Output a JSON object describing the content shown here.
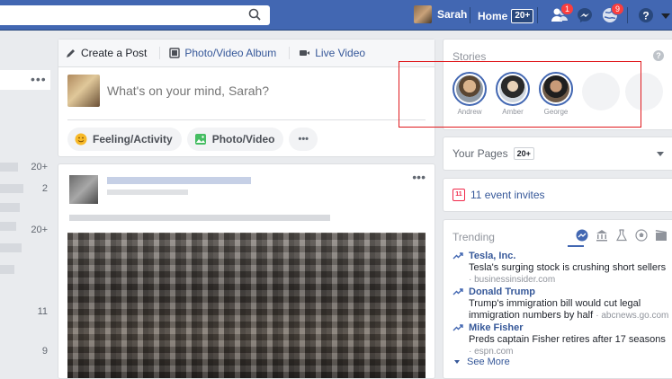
{
  "topbar": {
    "search_placeholder": "",
    "user_name": "Sarah",
    "home_label": "Home",
    "home_count": "20+",
    "friend_requests_count": "1",
    "notifications_count": "9"
  },
  "left_nav": {
    "counts": [
      "20+",
      "2",
      "20+",
      "11",
      "9"
    ]
  },
  "composer": {
    "tab_create": "Create a Post",
    "tab_album": "Photo/Video Album",
    "tab_live": "Live Video",
    "input_placeholder": "What's on your mind, Sarah?",
    "btn_feeling": "Feeling/Activity",
    "btn_photo": "Photo/Video",
    "btn_more": "•••"
  },
  "stories": {
    "title": "Stories",
    "items": [
      {
        "name": "Andrew"
      },
      {
        "name": "Amber"
      },
      {
        "name": "George"
      }
    ]
  },
  "pages": {
    "title": "Your Pages",
    "count": "20+"
  },
  "events": {
    "label": "11 event invites",
    "calendar_day": "11"
  },
  "trending": {
    "title": "Trending",
    "items": [
      {
        "topic": "Tesla, Inc.",
        "desc": "Tesla's surging stock is crushing short sellers",
        "source": "· businessinsider.com"
      },
      {
        "topic": "Donald Trump",
        "desc": "Trump's immigration bill would cut legal immigration numbers by half",
        "source": "· abcnews.go.com"
      },
      {
        "topic": "Mike Fisher",
        "desc": "Preds captain Fisher retires after 17 seasons",
        "source": "· espn.com"
      }
    ],
    "see_more": "See More"
  },
  "colors": {
    "brand": "#4267b2",
    "link": "#365899",
    "badge": "#fa3e3e",
    "highlight": "#e0191d"
  }
}
